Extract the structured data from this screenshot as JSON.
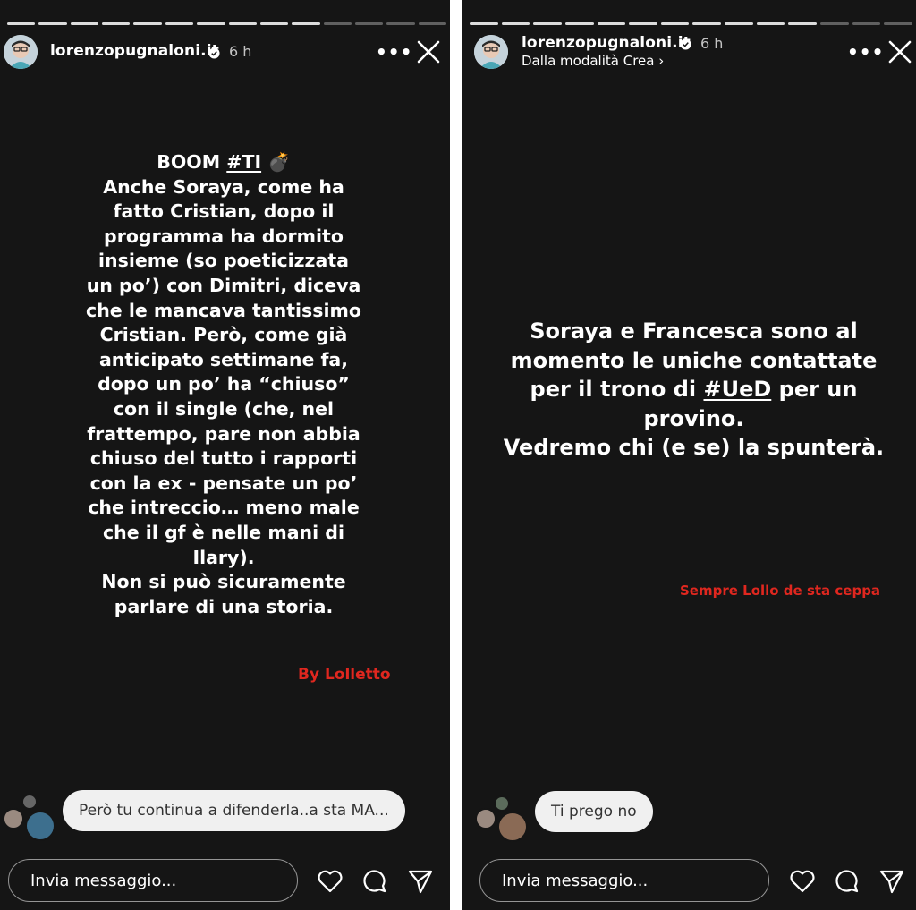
{
  "left_story": {
    "username": "lorenzopugnaloni.it",
    "time": "6 h",
    "lines": [
      "BOOM #TI 💣",
      "Anche Soraya, come ha",
      "fatto Cristian, dopo il",
      "programma ha dormito",
      "insieme (so poeticizzata",
      "un po’) con Dimitri, diceva",
      "che le mancava tantissimo",
      "Cristian. Però, come già",
      "anticipato settimane fa,",
      "dopo un po’ ha “chiuso”",
      "con il single (che, nel",
      "frattempo, pare non abbia",
      "chiuso del tutto i rapporti",
      "con la ex - pensate un po’",
      "che intreccio… meno male",
      "che il gf è nelle mani di",
      "Ilary).",
      "Non si può sicuramente",
      "parlare di una storia."
    ],
    "signature": "By Lolletto",
    "reply": "Però tu continua a difenderla..a sta MA...",
    "input_placeholder": "Invia messaggio..."
  },
  "right_story": {
    "username": "lorenzopugnaloni.it",
    "time": "6 h",
    "subtitle": "Dalla modalità Crea",
    "lines": [
      "Soraya e Francesca sono al",
      "momento le uniche contattate",
      "per il trono di #UeD per un",
      "provino.",
      "Vedremo chi (e se) la spunterà."
    ],
    "signature": "Sempre Lollo de sta ceppa",
    "reply": "Ti prego no",
    "input_placeholder": "Invia messaggio..."
  },
  "icons": [
    "more-icon",
    "close-icon",
    "verified-icon",
    "heart-icon",
    "comment-icon",
    "send-icon"
  ],
  "colors": {
    "background": "#151515",
    "accent_red": "#e0271f",
    "bubble": "#f0f0f0"
  }
}
